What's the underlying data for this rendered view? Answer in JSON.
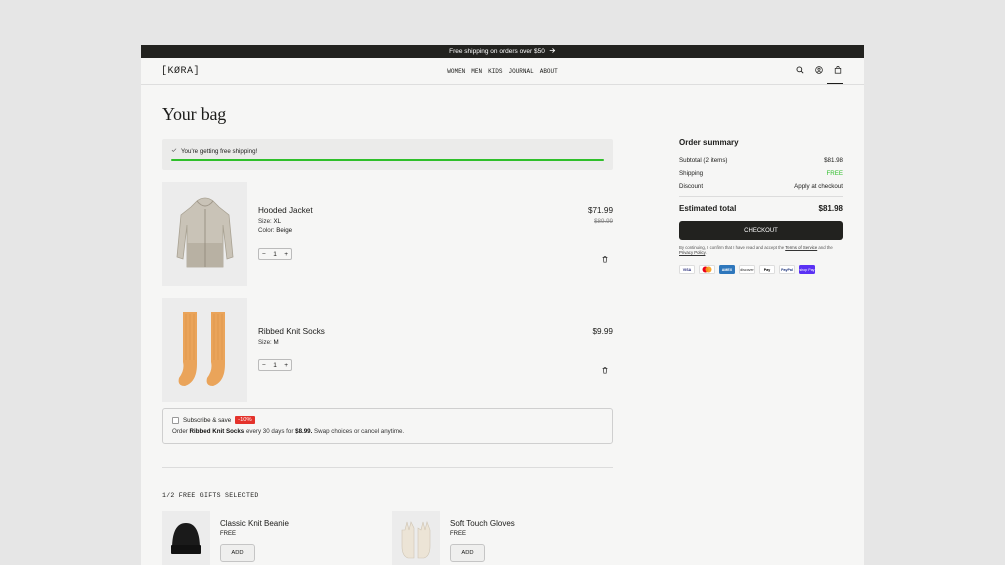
{
  "promo": {
    "text": "Free shipping on orders over $50"
  },
  "header": {
    "logo": "[KØRA]",
    "nav": [
      "WOMEN",
      "MEN",
      "KIDS",
      "JOURNAL",
      "ABOUT"
    ]
  },
  "cart": {
    "title": "Your bag",
    "shipping_message": "You're getting free shipping!",
    "shipping_progress": 1.0,
    "items": [
      {
        "name": "Hooded Jacket",
        "size_label": "Size:",
        "size": "XL",
        "color_label": "Color:",
        "color": "Beige",
        "price": "$71.99",
        "original_price": "$89.99",
        "qty": "1"
      },
      {
        "name": "Ribbed Knit Socks",
        "size_label": "Size:",
        "size": "M",
        "price": "$9.99",
        "qty": "1"
      }
    ],
    "qty_minus": "−",
    "qty_plus": "+",
    "subscribe": {
      "label": "Subscribe & save",
      "badge": "-10%",
      "desc_prefix": "Order ",
      "desc_product": "Ribbed Knit Socks",
      "desc_middle": " every 30 days for ",
      "desc_price": "$8.99.",
      "desc_suffix": " Swap choices or cancel anytime."
    }
  },
  "gifts": {
    "label": "1/2 FREE GIFTS SELECTED",
    "items": [
      {
        "name": "Classic Knit Beanie",
        "price": "FREE",
        "button": "ADD"
      },
      {
        "name": "Soft Touch Gloves",
        "price": "FREE",
        "button": "ADD"
      }
    ]
  },
  "summary": {
    "title": "Order summary",
    "subtotal_label": "Subtotal (2 items)",
    "subtotal": "$81.98",
    "shipping_label": "Shipping",
    "shipping": "FREE",
    "discount_label": "Discount",
    "discount": "Apply at checkout",
    "total_label": "Estimated total",
    "total": "$81.98",
    "checkout": "CHECKOUT",
    "legal_prefix": "By continuing, I confirm that I have read and accept the ",
    "terms": "Terms of Service",
    "legal_and": " and the ",
    "privacy": "Privacy Policy",
    "legal_end": ".",
    "payments": [
      "VISA",
      "",
      "AMEX",
      "discover",
      "Pay",
      "PayPal",
      "shop Pay"
    ]
  },
  "colors": {
    "accent_green": "#2fbf2a",
    "dark": "#22221f",
    "badge_red": "#e4322b"
  },
  "icons": [
    "arrow-right-icon",
    "search-icon",
    "account-icon",
    "bag-icon",
    "check-icon",
    "trash-icon"
  ]
}
